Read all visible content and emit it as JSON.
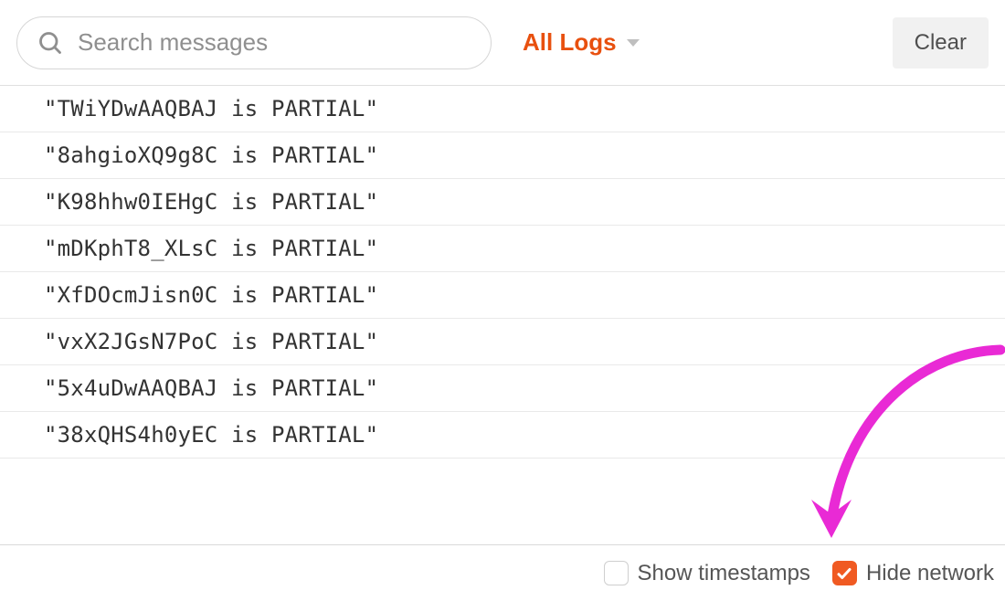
{
  "toolbar": {
    "search_placeholder": "Search messages",
    "filter_label": "All Logs",
    "clear_label": "Clear"
  },
  "logs": [
    "\"TWiYDwAAQBAJ is PARTIAL\"",
    "\"8ahgioXQ9g8C is PARTIAL\"",
    "\"K98hhw0IEHgC is PARTIAL\"",
    "\"mDKphT8_XLsC is PARTIAL\"",
    "\"XfDOcmJisn0C is PARTIAL\"",
    "\"vxX2JGsN7PoC is PARTIAL\"",
    "\"5x4uDwAAQBAJ is PARTIAL\"",
    "\"38xQHS4h0yEC is PARTIAL\""
  ],
  "footer": {
    "show_timestamps_label": "Show timestamps",
    "show_timestamps_checked": false,
    "hide_network_label": "Hide network",
    "hide_network_checked": true
  },
  "colors": {
    "accent": "#e8500f",
    "checkbox_on": "#f05a22",
    "annotation": "#e92ad5"
  }
}
